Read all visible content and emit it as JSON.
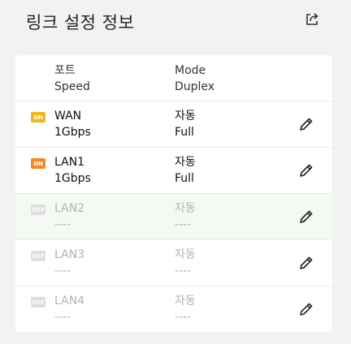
{
  "page": {
    "title": "링크 설정 정보"
  },
  "colors": {
    "on_wan": "#f3b51f",
    "on_lan": "#f08a23",
    "off": "#dedede"
  },
  "table": {
    "header": {
      "port": "포트",
      "speed": "Speed",
      "mode": "Mode",
      "duplex": "Duplex"
    },
    "rows": [
      {
        "badge": "ON",
        "port": "WAN",
        "speed": "1Gbps",
        "mode": "자동",
        "duplex": "Full"
      },
      {
        "badge": "ON",
        "port": "LAN1",
        "speed": "1Gbps",
        "mode": "자동",
        "duplex": "Full"
      },
      {
        "badge": "OFF",
        "port": "LAN2",
        "speed": "----",
        "mode": "자동",
        "duplex": "----"
      },
      {
        "badge": "OFF",
        "port": "LAN3",
        "speed": "----",
        "mode": "자동",
        "duplex": "----"
      },
      {
        "badge": "OFF",
        "port": "LAN4",
        "speed": "----",
        "mode": "자동",
        "duplex": "----"
      }
    ]
  },
  "icons": {
    "export": "export-icon",
    "edit": "pencil-icon"
  }
}
